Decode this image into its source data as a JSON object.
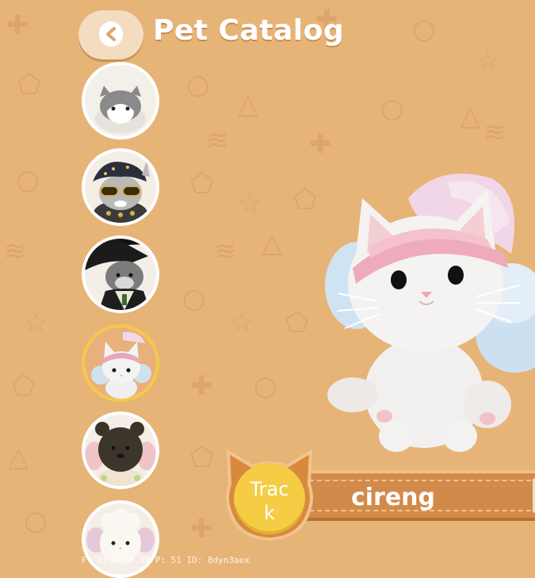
{
  "header": {
    "back_icon": "chevron-left-icon",
    "title": "Pet Catalog"
  },
  "pet_list": {
    "items": [
      {
        "name": "pet-grey-hood",
        "selected": false
      },
      {
        "name": "pet-sunglasses",
        "selected": false
      },
      {
        "name": "pet-witch-hat",
        "selected": false
      },
      {
        "name": "pet-pink-headband",
        "selected": true
      },
      {
        "name": "pet-dark-bear",
        "selected": false
      },
      {
        "name": "pet-white-sheep",
        "selected": false
      }
    ]
  },
  "selected_pet": {
    "name": "cireng",
    "track_label": "Trac\nk"
  },
  "debug": {
    "text": "F: 17    T: 0.00    P: 51    ID: 8dyn3aex"
  },
  "colors": {
    "background": "#e7b477",
    "pattern": "#dca66a",
    "bar": "#d28a4a",
    "track_button": "#f4cd45",
    "selected_ring": "#f4c948"
  }
}
